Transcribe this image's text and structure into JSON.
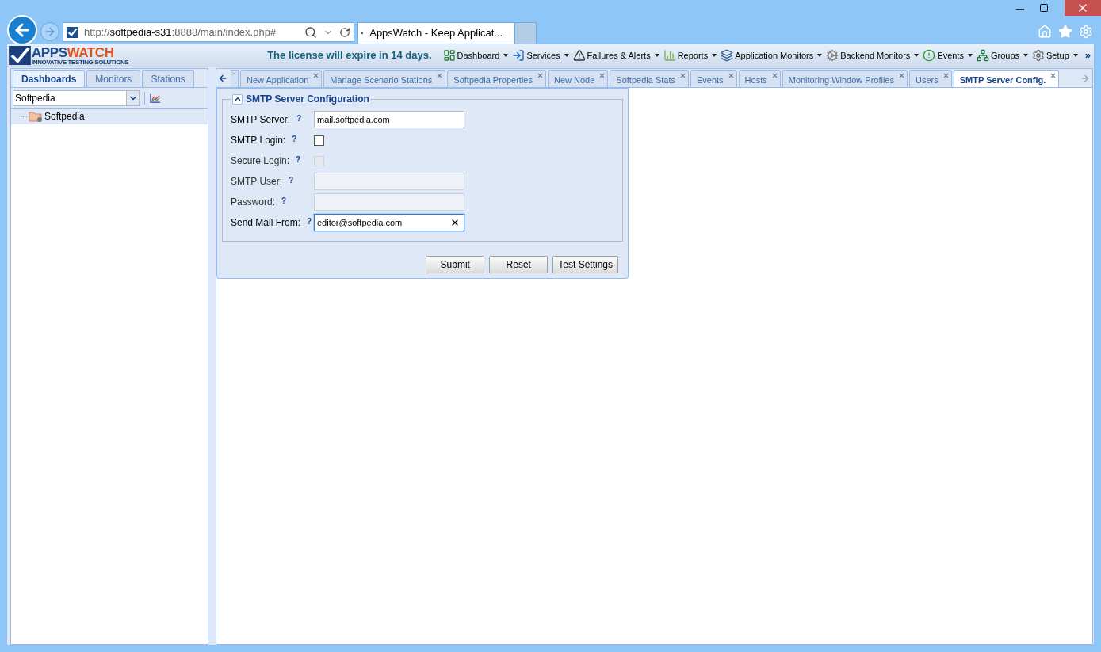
{
  "browser": {
    "address": {
      "prefix": "http://",
      "host": "softpedia-s31",
      "rest": ":8888/main/index.php#"
    },
    "tab_title": "AppsWatch - Keep Applicat..."
  },
  "app": {
    "logo": {
      "brand_a": "APPS",
      "brand_b": "WATCH",
      "tagline": "INNOVATIVE TESTING SOLUTIONS"
    },
    "license_notice": "The license will expire in 14 days.",
    "menu": [
      {
        "label": "Dashboard"
      },
      {
        "label": "Services"
      },
      {
        "label": "Failures & Alerts"
      },
      {
        "label": "Reports"
      },
      {
        "label": "Application Monitors"
      },
      {
        "label": "Backend Monitors"
      },
      {
        "label": "Events"
      },
      {
        "label": "Groups"
      },
      {
        "label": "Setup"
      }
    ],
    "menu_more": "»"
  },
  "sidebar": {
    "tabs": [
      {
        "label": "Dashboards",
        "selected": true
      },
      {
        "label": "Monitors",
        "selected": false
      },
      {
        "label": "Stations",
        "selected": false
      }
    ],
    "dashboard_select": "Softpedia",
    "tree": [
      {
        "label": "Softpedia",
        "selected": true
      }
    ]
  },
  "tabs": [
    {
      "label": "New Application",
      "selected": false
    },
    {
      "label": "Manage Scenario Stations",
      "selected": false
    },
    {
      "label": "Softpedia Properties",
      "selected": false
    },
    {
      "label": "New Node",
      "selected": false
    },
    {
      "label": "Softpedia Stats",
      "selected": false
    },
    {
      "label": "Events",
      "selected": false
    },
    {
      "label": "Hosts",
      "selected": false
    },
    {
      "label": "Monitoring Window Profiles",
      "selected": false
    },
    {
      "label": "Users",
      "selected": false
    },
    {
      "label": "SMTP Server Config.",
      "selected": true
    }
  ],
  "form": {
    "title": "SMTP Server Configuration",
    "expanded": true,
    "fields": [
      {
        "label": "SMTP Server:",
        "kind": "text",
        "value": "mail.softpedia.com",
        "disabled": false,
        "focused": false
      },
      {
        "label": "SMTP Login:",
        "kind": "checkbox",
        "checked": false,
        "disabled": false
      },
      {
        "label": "Secure Login:",
        "kind": "checkbox",
        "checked": false,
        "disabled": true
      },
      {
        "label": "SMTP User:",
        "kind": "text",
        "disabled": true,
        "focused": false
      },
      {
        "label": "Password:",
        "kind": "text",
        "disabled": true,
        "focused": false
      },
      {
        "label": "Send Mail From:",
        "kind": "text",
        "value": "editor@softpedia.com",
        "disabled": false,
        "focused": true
      }
    ],
    "help_mark": "?",
    "buttons": [
      "Submit",
      "Reset",
      "Test Settings"
    ]
  }
}
